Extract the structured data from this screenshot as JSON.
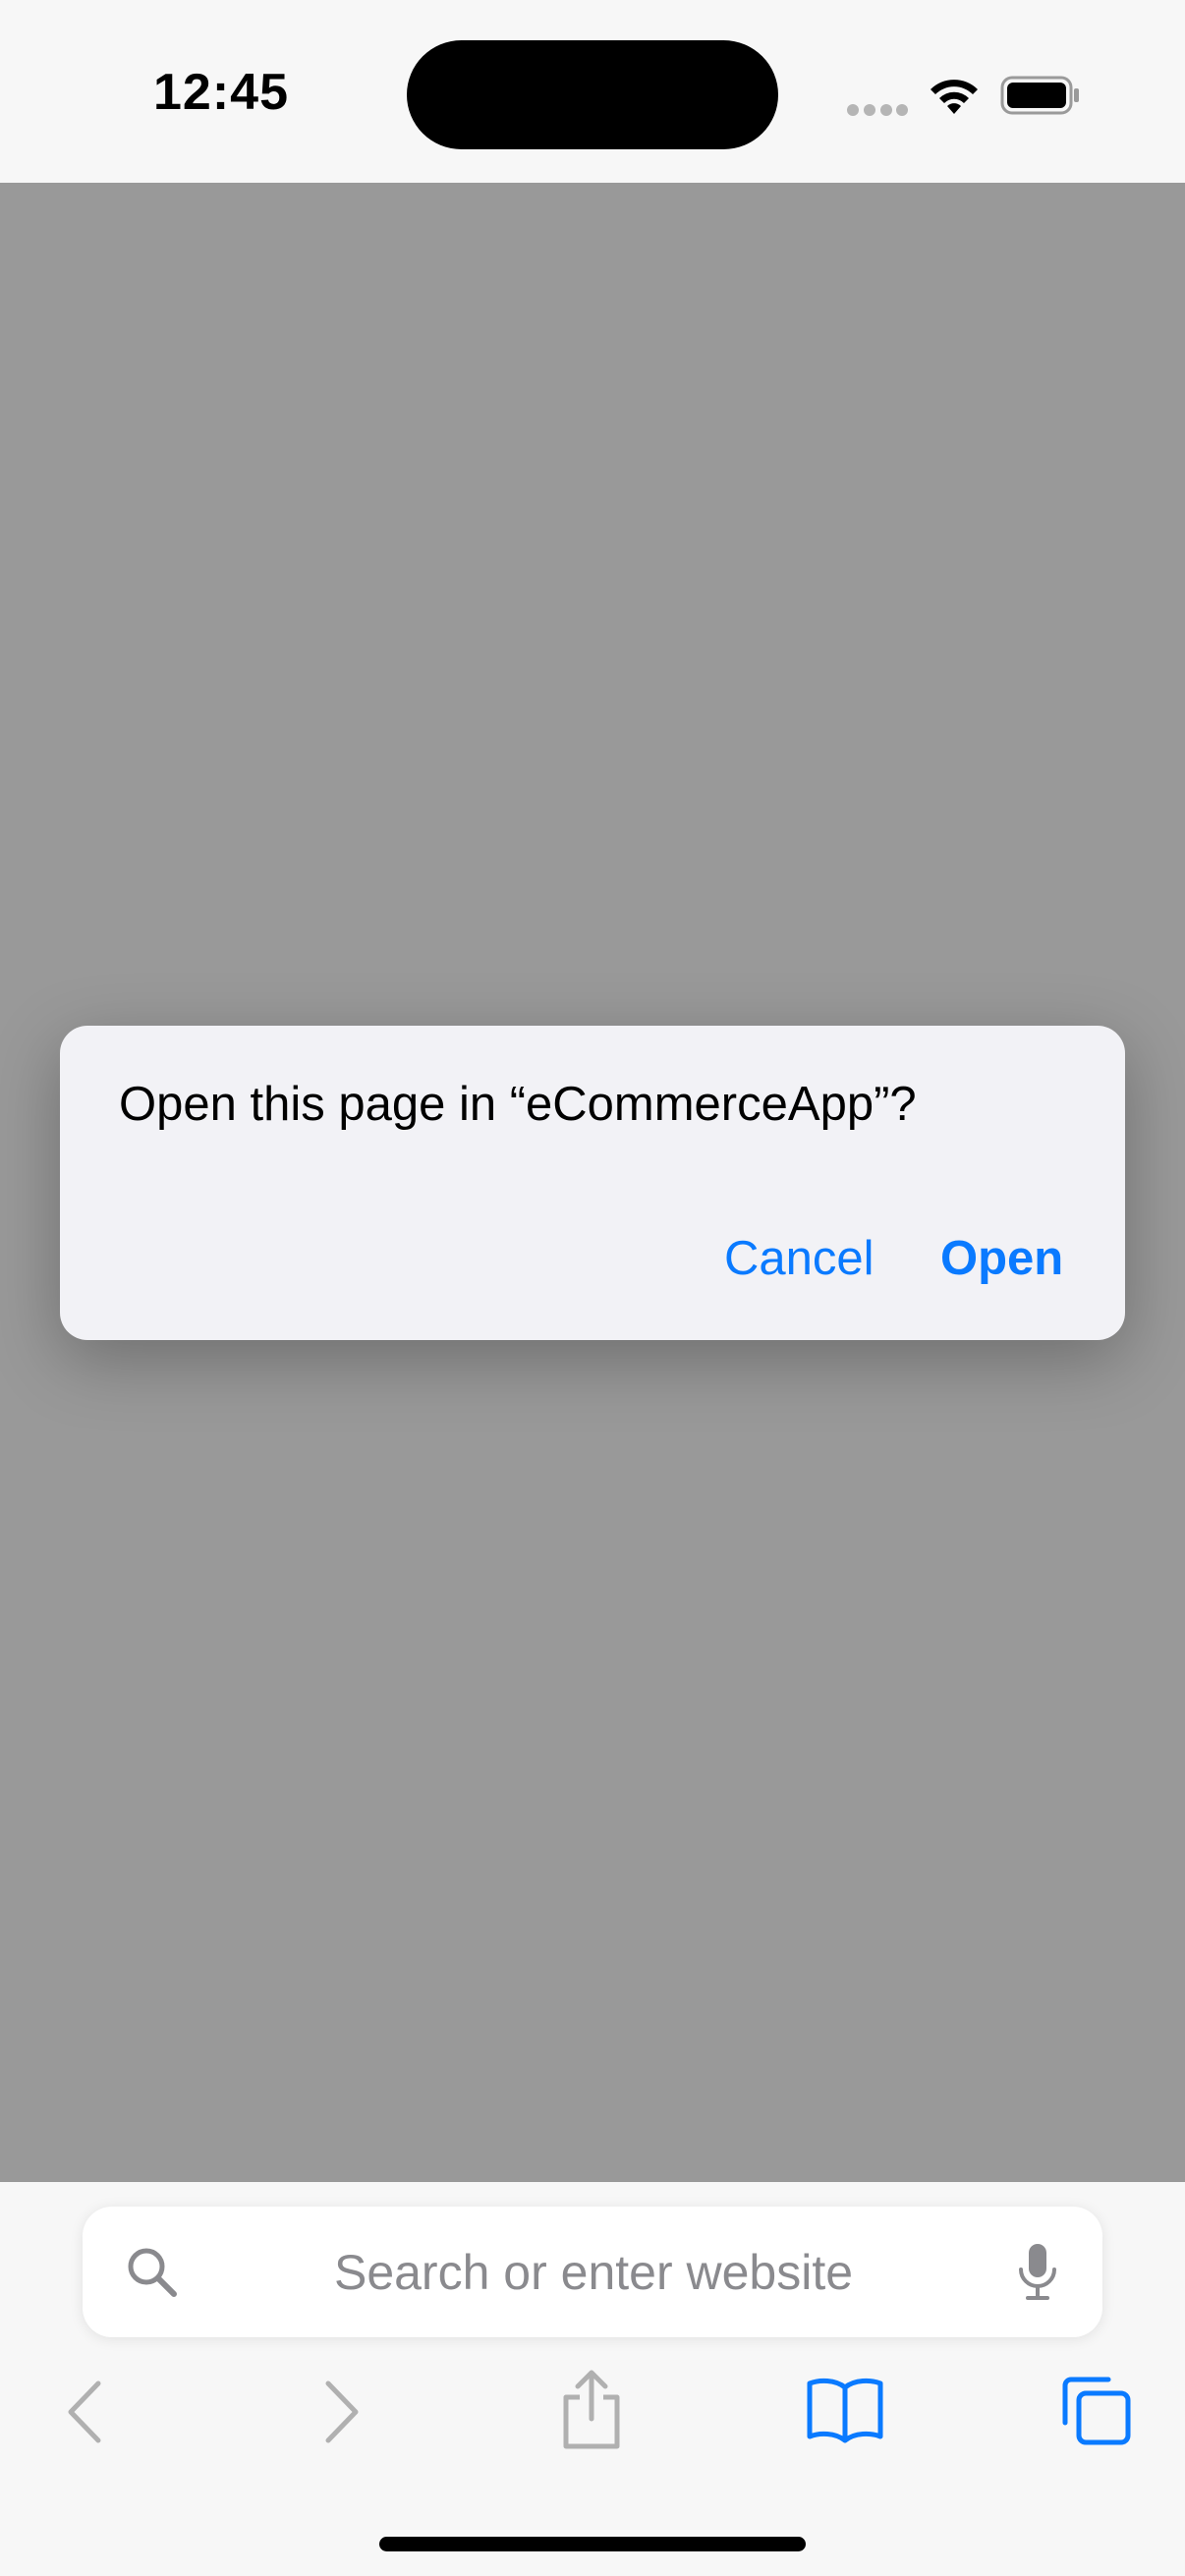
{
  "status_bar": {
    "time": "12:45"
  },
  "alert": {
    "message": "Open this page in “eCommerceApp”?",
    "cancel_label": "Cancel",
    "open_label": "Open"
  },
  "search": {
    "placeholder": "Search or enter website",
    "value": ""
  },
  "icons": {
    "search": "search-icon",
    "microphone": "microphone-icon",
    "back": "chevron-left-icon",
    "forward": "chevron-right-icon",
    "share": "share-icon",
    "bookmarks": "book-icon",
    "tabs": "tabs-icon"
  },
  "colors": {
    "accent": "#0a7aff",
    "disabled": "#b0b0b0",
    "dim_overlay": "rgba(0,0,0,0.4)",
    "alert_bg": "#f2f2f6"
  }
}
